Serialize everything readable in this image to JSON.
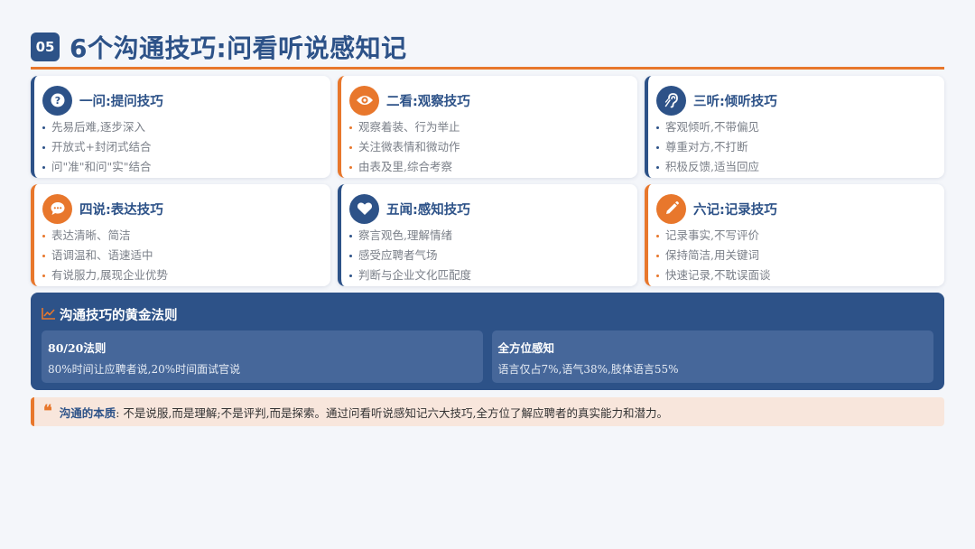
{
  "header": {
    "number": "05",
    "title": "6个沟通技巧:问看听说感知记"
  },
  "cards": [
    {
      "title": "一问:提问技巧",
      "icon": "question-icon",
      "items": [
        "先易后难,逐步深入",
        "开放式+封闭式结合",
        "问\"准\"和问\"实\"结合"
      ]
    },
    {
      "title": "二看:观察技巧",
      "icon": "eye-icon",
      "items": [
        "观察着装、行为举止",
        "关注微表情和微动作",
        "由表及里,综合考察"
      ]
    },
    {
      "title": "三听:倾听技巧",
      "icon": "ear-icon",
      "items": [
        "客观倾听,不带偏见",
        "尊重对方,不打断",
        "积极反馈,适当回应"
      ]
    },
    {
      "title": "四说:表达技巧",
      "icon": "chat-bubble-icon",
      "items": [
        "表达清晰、简洁",
        "语调温和、语速适中",
        "有说服力,展现企业优势"
      ]
    },
    {
      "title": "五闻:感知技巧",
      "icon": "heart-icon",
      "items": [
        "察言观色,理解情绪",
        "感受应聘者气场",
        "判断与企业文化匹配度"
      ]
    },
    {
      "title": "六记:记录技巧",
      "icon": "pencil-icon",
      "items": [
        "记录事实,不写评价",
        "保持简洁,用关键词",
        "快速记录,不耽误面谈"
      ]
    }
  ],
  "golden": {
    "title": "沟通技巧的黄金法则",
    "icon": "chart-line-icon",
    "rules": [
      {
        "name": "80/20法则",
        "desc": "80%时间让应聘者说,20%时间面试官说"
      },
      {
        "name": "全方位感知",
        "desc": "语言仅占7%,语气38%,肢体语言55%"
      }
    ]
  },
  "quote": {
    "icon": "quote-icon",
    "label": "沟通的本质",
    "text": ": 不是说服,而是理解;不是评判,而是探索。通过问看听说感知记六大技巧,全方位了解应聘者的真实能力和潜力。"
  },
  "colors": {
    "primary": "#2d5288",
    "accent": "#e8772c",
    "background": "#f4f6fa"
  }
}
